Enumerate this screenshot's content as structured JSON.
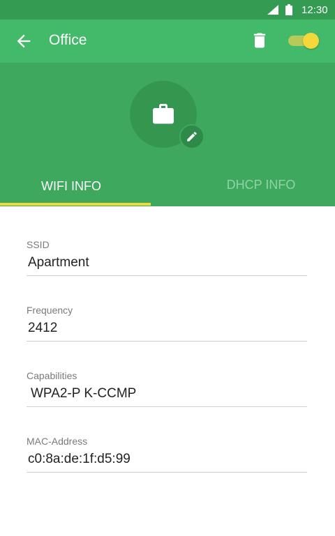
{
  "status_bar": {
    "time": "12:30"
  },
  "app_bar": {
    "title": "Office",
    "toggle_on": true
  },
  "colors": {
    "primary": "#43b96a",
    "primary_dark": "#349b52",
    "accent": "#f4d83a"
  },
  "tabs": [
    {
      "label": "WIFI INFO",
      "active": true
    },
    {
      "label": "DHCP INFO",
      "active": false
    }
  ],
  "fields": [
    {
      "label": "SSID",
      "value": "Apartment"
    },
    {
      "label": "Frequency",
      "value": "2412"
    },
    {
      "label": "Capabilities",
      "value": "WPA2-P K-CCMP"
    },
    {
      "label": "MAC-Address",
      "value": "c0:8a:de:1f:d5:99"
    }
  ],
  "icons": {
    "back": "arrow-left-icon",
    "delete": "trash-icon",
    "profile": "briefcase-icon",
    "edit": "pencil-icon"
  }
}
